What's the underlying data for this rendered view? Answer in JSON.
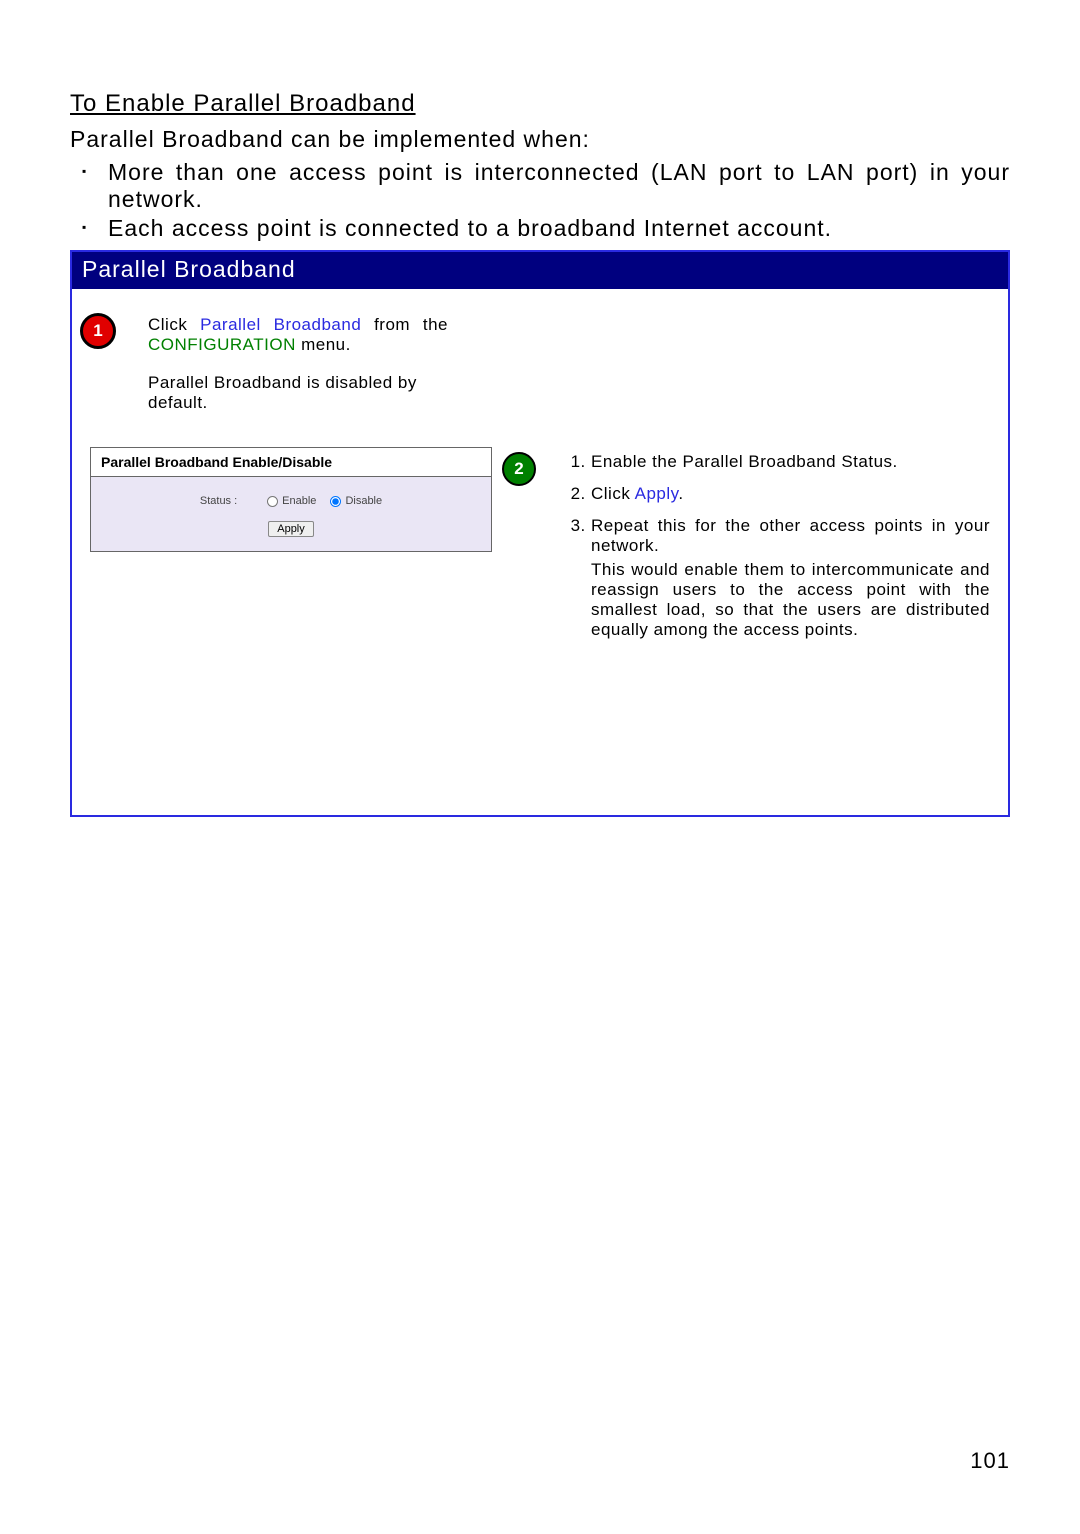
{
  "title": "To Enable Parallel Broadband",
  "intro": "Parallel Broadband can be implemented when:",
  "requirements": [
    "More than one access point is interconnected (LAN port to LAN port) in your network.",
    "Each access point is connected to a broadband Internet account."
  ],
  "box": {
    "header": "Parallel Broadband",
    "step1": {
      "badge": "1",
      "click": "Click ",
      "menuItem": "Parallel Broadband",
      "from": " from the ",
      "menuName": "CONFIGURATION",
      "menuSuffix": " menu.",
      "note": "Parallel Broadband is disabled by default."
    },
    "panel": {
      "title": "Parallel Broadband Enable/Disable",
      "statusLabel": "Status :",
      "enable": "Enable",
      "disable": "Disable",
      "apply": "Apply"
    },
    "step2": {
      "badge": "2",
      "items": {
        "i1": "Enable the Parallel Broadband Status.",
        "i2_pre": "Click ",
        "i2_link": "Apply",
        "i2_post": ".",
        "i3a": "Repeat this for the other access points in your network.",
        "i3b": "This would enable them to intercommunicate and reassign users to the access point with the smallest load, so that the users are distributed equally among the access points."
      }
    }
  },
  "pageNumber": "101"
}
